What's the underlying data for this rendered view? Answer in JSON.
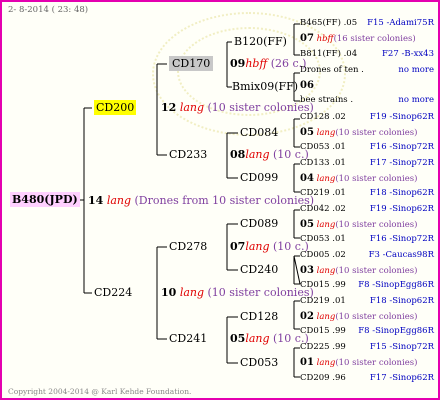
{
  "header": {
    "date": "2-  8-2014 ( 23: 48)"
  },
  "footer": {
    "copyright": "Copyright 2004-2014 @ Karl Kehde Foundation."
  },
  "colors": {
    "frame": "#e400b0",
    "blue": "#0000c0",
    "purple": "#8040a0",
    "red": "#e00000"
  },
  "root": {
    "label": "B480(JPD)"
  },
  "g1": [
    {
      "label": "CD200"
    },
    {
      "label": "CD224"
    }
  ],
  "g1_link": {
    "num": "14",
    "word": "lang",
    "text": "(Drones from 10 sister colonies)"
  },
  "g2": [
    {
      "label": "CD170"
    },
    {
      "label": "CD233"
    },
    {
      "label": "CD278"
    },
    {
      "label": "CD241"
    }
  ],
  "g2_links": [
    {
      "num": "12",
      "word": "lang",
      "text": "(10 sister colonies)"
    },
    {
      "num": "10",
      "word": "lang",
      "text": "(10 sister colonies)"
    }
  ],
  "g3": [
    {
      "label": "B120(FF)"
    },
    {
      "label": "Bmix09(FF)"
    },
    {
      "label": "CD084"
    },
    {
      "label": "CD099"
    },
    {
      "label": "CD089"
    },
    {
      "label": "CD240"
    },
    {
      "label": "CD128"
    },
    {
      "label": "CD053"
    }
  ],
  "g3_links": [
    {
      "num": "09",
      "word": "hbff",
      "text": "(26 c.)"
    },
    {
      "num": "08",
      "word": "lang",
      "text": "(10 c.)"
    },
    {
      "num": "07",
      "word": "lang",
      "text": "(10 c.)"
    },
    {
      "num": "05",
      "word": "lang",
      "text": "(10 c.)"
    }
  ],
  "g4": [
    {
      "left": "B465(FF) .05",
      "right": "F15 -Adami75R"
    },
    {
      "num": "07",
      "word": "hbff",
      "text": "(16 sister colonies)"
    },
    {
      "left": "B811(FF) .04",
      "right": "F27 -B-xx43"
    },
    {
      "left": "Drones of ten .",
      "right": "no more"
    },
    {
      "num": "06",
      "word": "",
      "text": ""
    },
    {
      "left": "bee strains .",
      "right": "no more"
    },
    {
      "left": "CD128 .02",
      "right": "F19 -Sinop62R"
    },
    {
      "num": "05",
      "word": "lang",
      "text": "(10 sister colonies)"
    },
    {
      "left": "CD053 .01",
      "right": "F16 -Sinop72R"
    },
    {
      "left": "CD133 .01",
      "right": "F17 -Sinop72R"
    },
    {
      "num": "04",
      "word": "lang",
      "text": "(10 sister colonies)"
    },
    {
      "left": "CD219 .01",
      "right": "F18 -Sinop62R"
    },
    {
      "left": "CD042 .02",
      "right": "F19 -Sinop62R"
    },
    {
      "num": "05",
      "word": "lang",
      "text": "(10 sister colonies)"
    },
    {
      "left": "CD053 .01",
      "right": "F16 -Sinop72R"
    },
    {
      "left": "CD005 .02",
      "right": "F3 -Caucas98R"
    },
    {
      "num": "03",
      "word": "lang",
      "text": "(10 sister colonies)"
    },
    {
      "left": "CD015 .99",
      "right": "F8 -SinopEgg86R"
    },
    {
      "left": "CD219 .01",
      "right": "F18 -Sinop62R"
    },
    {
      "num": "02",
      "word": "lang",
      "text": "(10 sister colonies)"
    },
    {
      "left": "CD015 .99",
      "right": "F8 -SinopEgg86R"
    },
    {
      "left": "CD225 .99",
      "right": "F15 -Sinop72R"
    },
    {
      "num": "01",
      "word": "lang",
      "text": "(10 sister colonies)"
    },
    {
      "left": "CD209 .96",
      "right": "F17 -Sinop62R"
    }
  ]
}
